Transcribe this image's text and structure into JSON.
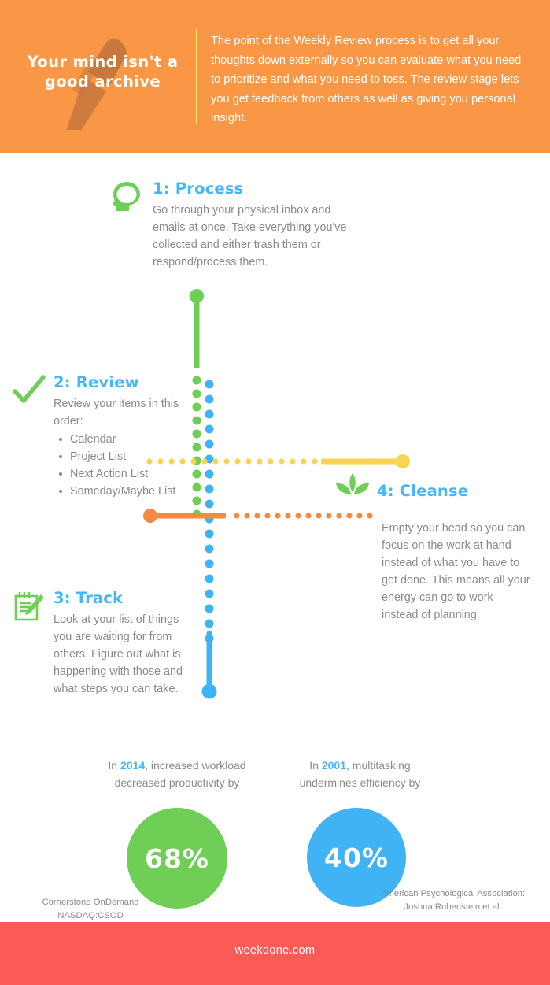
{
  "header": {
    "title": "Your mind isn't a good archive",
    "body": "The point of the Weekly Review process is to get all your thoughts down externally so you can evaluate what you need to prioritize and what you need to toss. The review stage lets you get feedback from others as well as giving you personal insight.",
    "bg_color": "#F99746",
    "rule_color": "#F7E96C",
    "pen_icon": "pen-icon"
  },
  "steps": [
    {
      "id": "process",
      "title": "1: Process",
      "body": "Go through your physical inbox and emails at once. Take everything you've collected and either trash them or respond/process them.",
      "icon": "head-icon",
      "icon_color": "#6ECE55",
      "title_color": "#45B7F7"
    },
    {
      "id": "review",
      "title": "2: Review",
      "body": "Review your items in this order:",
      "items": [
        "Calendar",
        "Project List",
        "Next Action List",
        "Someday/Maybe List"
      ],
      "icon": "checkmark-icon",
      "icon_color": "#6ECE55",
      "title_color": "#45B7F7"
    },
    {
      "id": "track",
      "title": "3: Track",
      "body": "Look at your list of things you are waiting for from others. Figure out what is happening with those and what steps you can take.",
      "icon": "notepad-pencil-icon",
      "icon_color": "#6ECE55",
      "title_color": "#45B7F7"
    },
    {
      "id": "cleanse",
      "title": "4: Cleanse",
      "body": "Empty your head so you can focus on the work at hand instead of what you have to get done. This means all your energy can go to work instead of planning.",
      "icon": "leaf-plant-icon",
      "icon_color": "#6ECE55",
      "title_color": "#45B7F7"
    }
  ],
  "timeline": {
    "green_color": "#6ECE55",
    "blue_color": "#3FB3F4",
    "yellow_color": "#F9D council",
    "yellow": "#F9D351",
    "orange_color": "#F58A43"
  },
  "chart_data": {
    "type": "bar",
    "title": "Weekly Review impact statistics",
    "categories": [
      "2014 — increased workload decreased productivity",
      "2001 — multitasking undermines efficiency"
    ],
    "values": [
      68,
      40
    ],
    "unit": "%",
    "ylim": [
      0,
      100
    ],
    "series": [
      {
        "name": "decreased productivity",
        "year": "2014",
        "value": 68,
        "color": "#6ECE55"
      },
      {
        "name": "undermines efficiency",
        "year": "2001",
        "value": 40,
        "color": "#3FB3F4"
      }
    ]
  },
  "stats": [
    {
      "year": "2014",
      "caption_before": "In ",
      "caption_after": ", increased workload decreased productivity by",
      "value": "68%",
      "color": "#6ECE55",
      "source": "Cornerstone OnDemand\nNASDAQ:CSOD",
      "source_line1": "Cornerstone OnDemand",
      "source_line2": "NASDAQ:CSOD"
    },
    {
      "year": "2001",
      "caption_before": "In ",
      "caption_after": ", multitasking undermines efficiency by",
      "value": "40%",
      "color": "#3FB3F4",
      "source_line1": "American Psychological Association:",
      "source_line2": "Joshua Rubenstein et al."
    }
  ],
  "footer": {
    "text": "weekdone.com",
    "bg_color": "#FB5B57"
  }
}
